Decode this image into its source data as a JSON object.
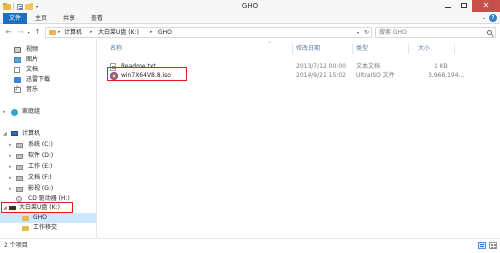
{
  "window": {
    "title": "GHO",
    "close_glyph": "✕"
  },
  "quick_access": {
    "dropdown_glyph": "▾"
  },
  "ribbon": {
    "tabs": [
      "文件",
      "主页",
      "共享",
      "查看"
    ],
    "expand_glyph": "⌄",
    "help_glyph": "?"
  },
  "address": {
    "back_glyph": "←",
    "forward_glyph": "→",
    "recent_glyph": "▾",
    "up_glyph": "↑",
    "separator": "▸",
    "breadcrumbs": [
      "计算机",
      "大白菜U盘 (K:)",
      "GHO"
    ],
    "dropdown_glyph": "▾",
    "refresh_glyph": "↻"
  },
  "search": {
    "placeholder": "搜索 GHO"
  },
  "nav_pane": {
    "expand_glyph": "▸",
    "expanded_glyph": "◢",
    "favorites_items": [
      "视频",
      "图片",
      "文档",
      "迅雷下载",
      "音乐"
    ],
    "homegroup": "家庭组",
    "computer": "计算机",
    "drives": [
      "系统 (C:)",
      "软件 (D:)",
      "工作 (E:)",
      "文档 (F:)",
      "影视 (G:)",
      "CD 驱动器 (H:)",
      "大白菜U盘 (K:)"
    ],
    "subfolders": [
      "GHO",
      "工作移交"
    ]
  },
  "columns": {
    "name": "名称",
    "modified": "修改日期",
    "type": "类型",
    "size": "大小",
    "sort_glyph": "^"
  },
  "files": [
    {
      "name": "Readme.txt",
      "modified": "2013/7/12 00:00",
      "type": "文本文档",
      "size": "1 KB",
      "icon": "text-file-icon"
    },
    {
      "name": "win7X64V8.8.iso",
      "modified": "2014/9/21 15:02",
      "type": "UltraISO 文件",
      "size": "3,968,194...",
      "icon": "iso-file-icon"
    }
  ],
  "status": {
    "item_count": "2 个项目"
  },
  "colors": {
    "accent": "#1a6fc4",
    "highlight_box": "#e02020",
    "selected_nav": "#cce8ff",
    "close_button": "#c7504a"
  }
}
